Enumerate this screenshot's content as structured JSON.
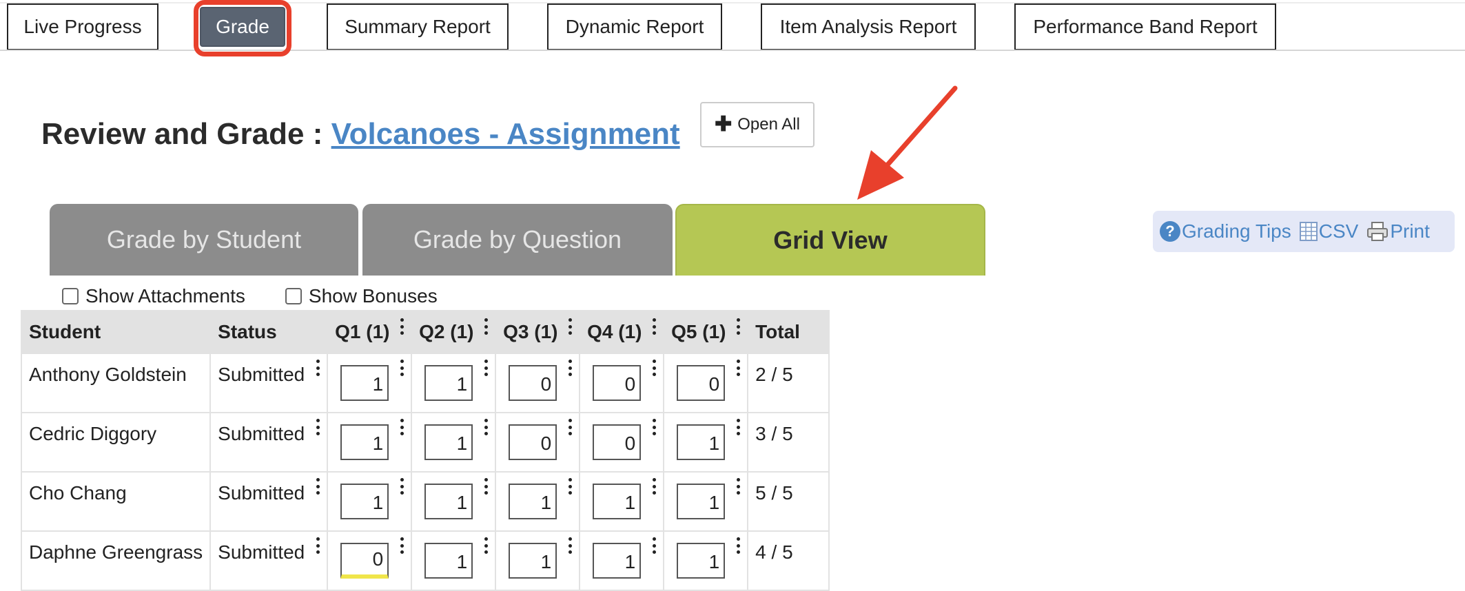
{
  "nav": {
    "items": [
      {
        "label": "Live Progress"
      },
      {
        "label": "Grade",
        "active": true
      },
      {
        "label": "Summary Report"
      },
      {
        "label": "Dynamic Report"
      },
      {
        "label": "Item Analysis Report"
      },
      {
        "label": "Performance Band Report"
      }
    ]
  },
  "heading": {
    "prefix": "Review and Grade : ",
    "assignment_link": "Volcanoes - Assignment"
  },
  "open_all_label": "Open All",
  "tabs": [
    {
      "label": "Grade by Student"
    },
    {
      "label": "Grade by Question"
    },
    {
      "label": "Grid View",
      "active": true
    }
  ],
  "tools": {
    "grading_tips": "Grading Tips",
    "csv": "CSV",
    "print": "Print"
  },
  "options": {
    "show_attachments": "Show Attachments",
    "show_bonuses": "Show Bonuses"
  },
  "table": {
    "headers": [
      "Student",
      "Status",
      "Q1 (1)",
      "Q2 (1)",
      "Q3 (1)",
      "Q4 (1)",
      "Q5 (1)",
      "Total"
    ],
    "rows": [
      {
        "student": "Anthony Goldstein",
        "status": "Submitted",
        "scores": [
          "1",
          "1",
          "0",
          "0",
          "0"
        ],
        "total": "2 / 5"
      },
      {
        "student": "Cedric Diggory",
        "status": "Submitted",
        "scores": [
          "1",
          "1",
          "0",
          "0",
          "1"
        ],
        "total": "3 / 5"
      },
      {
        "student": "Cho Chang",
        "status": "Submitted",
        "scores": [
          "1",
          "1",
          "1",
          "1",
          "1"
        ],
        "total": "5 / 5"
      },
      {
        "student": "Daphne Greengrass",
        "status": "Submitted",
        "scores": [
          "0",
          "1",
          "1",
          "1",
          "1"
        ],
        "total": "4 / 5"
      }
    ]
  },
  "colors": {
    "active_nav": "#5a6472",
    "highlight": "#e8402c",
    "grid_view_tab": "#b5c754",
    "inactive_tab": "#8c8c8c",
    "link": "#4a86c5",
    "flag": "#f0e54a"
  }
}
